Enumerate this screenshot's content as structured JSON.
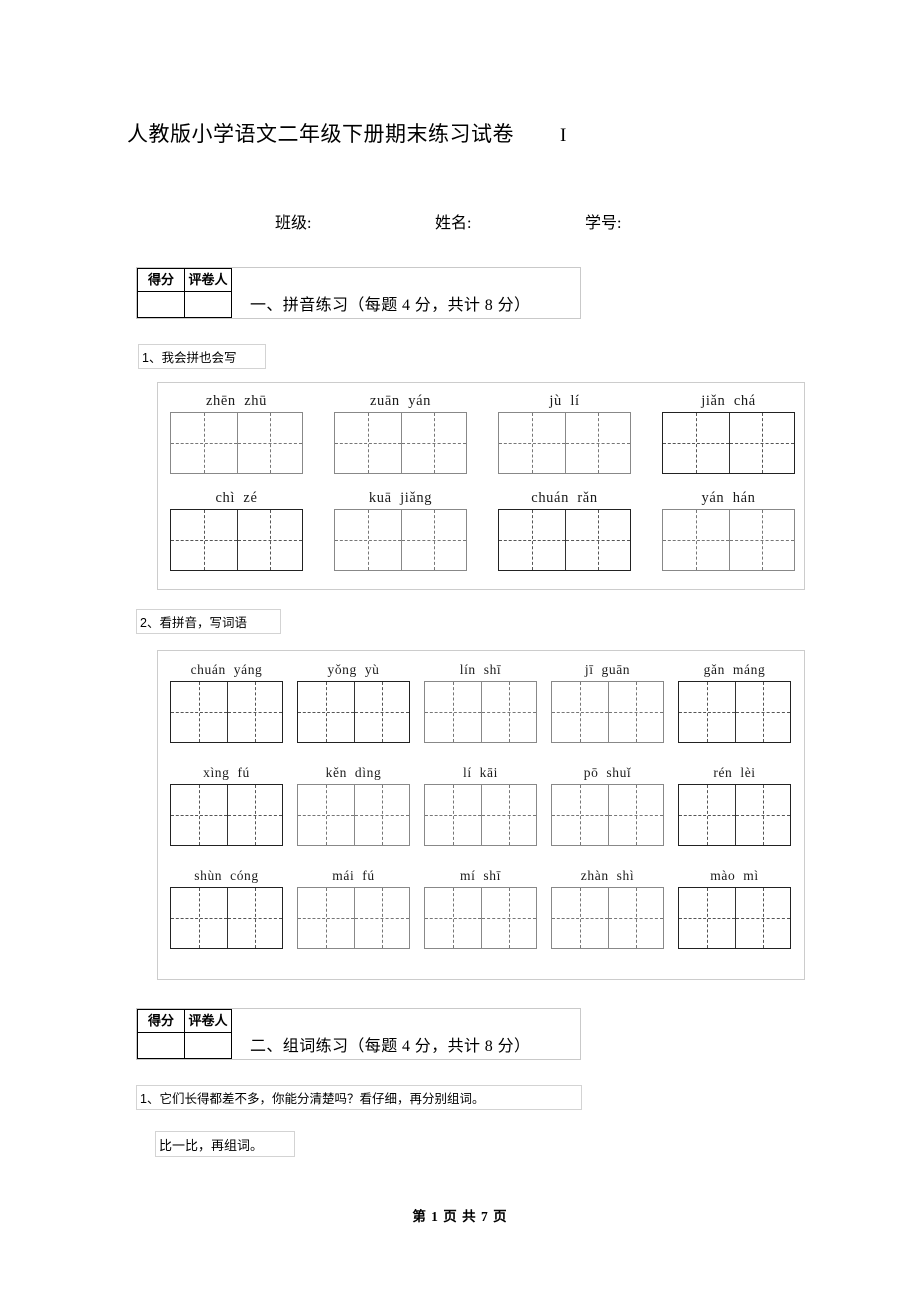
{
  "document": {
    "title": "人教版小学语文二年级下册期末练习试卷",
    "title_marker": "I",
    "fields": {
      "class_label": "班级:",
      "name_label": "姓名:",
      "student_id_label": "学号:"
    },
    "footer": "第 1 页 共 7 页"
  },
  "score_header": {
    "score_label": "得分",
    "grader_label": "评卷人",
    "score_value": "",
    "grader_value": ""
  },
  "sections": [
    {
      "heading": "一、拼音练习（每题 4 分，共计 8 分）",
      "questions": [
        {
          "label": "1、我会拼也会写",
          "rows": [
            [
              {
                "syllables": [
                  "zhēn",
                  "zhū"
                ],
                "emphasis": "light"
              },
              {
                "syllables": [
                  "zuān",
                  "yán"
                ],
                "emphasis": "light"
              },
              {
                "syllables": [
                  "jù",
                  "lí"
                ],
                "emphasis": "light"
              },
              {
                "syllables": [
                  "jiǎn",
                  "chá"
                ],
                "emphasis": "dark"
              }
            ],
            [
              {
                "syllables": [
                  "chì",
                  "zé"
                ],
                "emphasis": "dark"
              },
              {
                "syllables": [
                  "kuā",
                  "jiǎng"
                ],
                "emphasis": "light"
              },
              {
                "syllables": [
                  "chuán",
                  "rǎn"
                ],
                "emphasis": "dark"
              },
              {
                "syllables": [
                  "yán",
                  "hán"
                ],
                "emphasis": "light"
              }
            ]
          ]
        },
        {
          "label": "2、看拼音，写词语",
          "rows": [
            [
              {
                "syllables": [
                  "chuán",
                  "yáng"
                ],
                "emphasis": "dark"
              },
              {
                "syllables": [
                  "yǒng",
                  "yù"
                ],
                "emphasis": "dark"
              },
              {
                "syllables": [
                  "lín",
                  "shī"
                ],
                "emphasis": "light"
              },
              {
                "syllables": [
                  "jī",
                  "guān"
                ],
                "emphasis": "light"
              },
              {
                "syllables": [
                  "gǎn",
                  "máng"
                ],
                "emphasis": "dark"
              }
            ],
            [
              {
                "syllables": [
                  "xìng",
                  "fú"
                ],
                "emphasis": "dark"
              },
              {
                "syllables": [
                  "kěn",
                  "dìng"
                ],
                "emphasis": "light"
              },
              {
                "syllables": [
                  "lí",
                  "kāi"
                ],
                "emphasis": "light"
              },
              {
                "syllables": [
                  "pō",
                  "shuǐ"
                ],
                "emphasis": "light"
              },
              {
                "syllables": [
                  "rén",
                  "lèi"
                ],
                "emphasis": "dark"
              }
            ],
            [
              {
                "syllables": [
                  "shùn",
                  "cóng"
                ],
                "emphasis": "dark"
              },
              {
                "syllables": [
                  "mái",
                  "fú"
                ],
                "emphasis": "light"
              },
              {
                "syllables": [
                  "mí",
                  "shī"
                ],
                "emphasis": "light"
              },
              {
                "syllables": [
                  "zhàn",
                  "shì"
                ],
                "emphasis": "light"
              },
              {
                "syllables": [
                  "mào",
                  "mì"
                ],
                "emphasis": "dark"
              }
            ]
          ]
        }
      ]
    },
    {
      "heading": "二、组词练习（每题 4 分，共计 8 分）",
      "questions": [
        {
          "label": "1、它们长得都差不多，你能分清楚吗？看仔细，再分别组词。",
          "sub_label": "比一比，再组词。",
          "rows": []
        }
      ]
    }
  ]
}
